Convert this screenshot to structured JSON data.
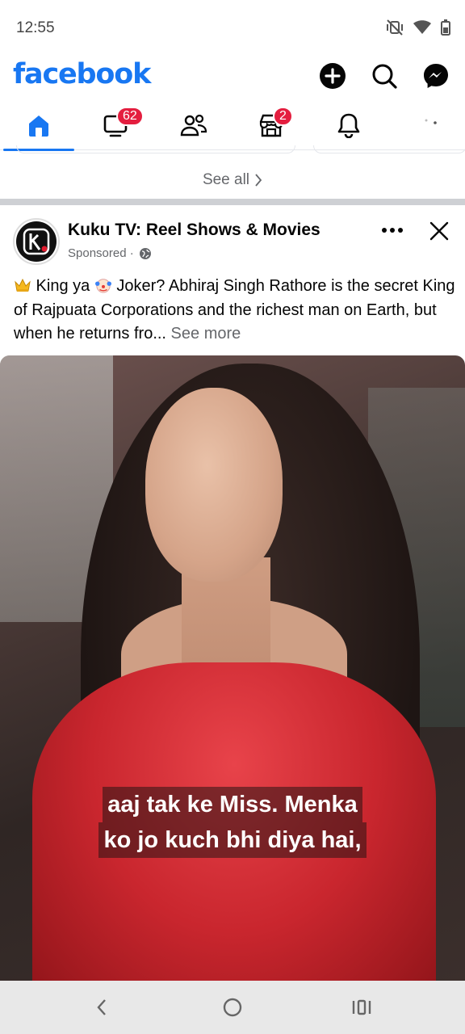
{
  "status_bar": {
    "time": "12:55"
  },
  "app": {
    "logo_text": "facebook",
    "brand_color": "#1877f2"
  },
  "header_actions": [
    {
      "icon": "plus-circle-icon"
    },
    {
      "icon": "search-icon"
    },
    {
      "icon": "messenger-icon"
    }
  ],
  "nav_tabs": [
    {
      "icon": "home-icon",
      "active": true
    },
    {
      "icon": "video-icon",
      "badge": "62"
    },
    {
      "icon": "friends-icon"
    },
    {
      "icon": "marketplace-icon",
      "badge": "2"
    },
    {
      "icon": "bell-icon"
    }
  ],
  "feed": {
    "see_all": "See all"
  },
  "post": {
    "page_name": "Kuku TV: Reel Shows & Movies",
    "sponsored": "Sponsored ·",
    "caption_part1": " King ya ",
    "caption_part2": " Joker? Abhiraj Singh Rathore is the secret King of Rajpuata Corporations and the richest man on Earth, but when he returns fro...",
    "see_more": "See more",
    "subtitle_line1": "aaj tak ke Miss. Menka",
    "subtitle_line2": "ko jo kuch bhi diya hai,"
  },
  "system_nav": [
    {
      "icon": "back-icon"
    },
    {
      "icon": "home-circle-icon"
    },
    {
      "icon": "recents-icon"
    }
  ]
}
